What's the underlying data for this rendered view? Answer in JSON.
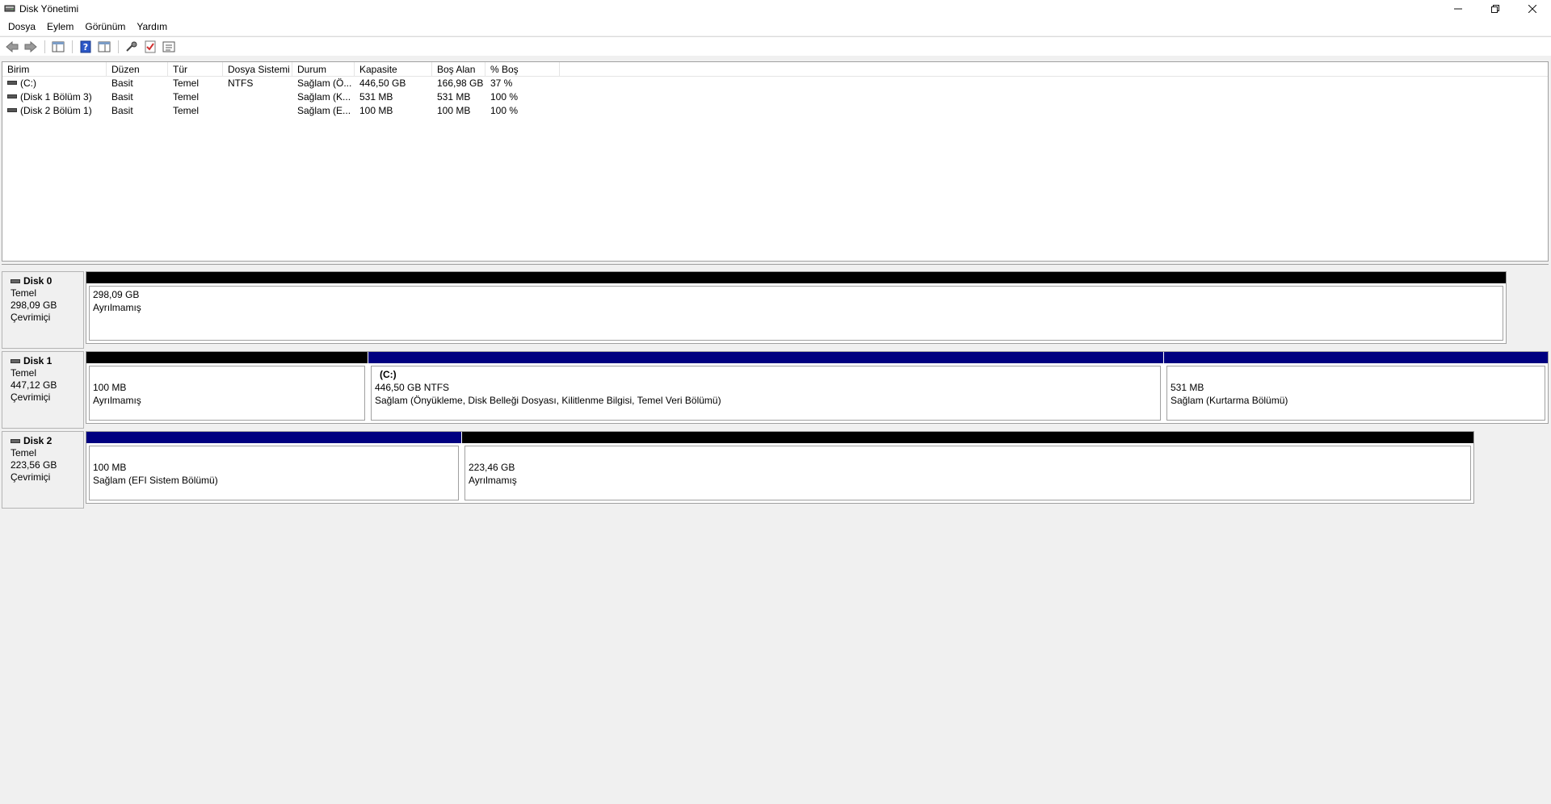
{
  "window": {
    "title": "Disk Yönetimi",
    "controls": {
      "minimize": "—",
      "restore": "❐",
      "close": "✕"
    }
  },
  "menu": [
    "Dosya",
    "Eylem",
    "Görünüm",
    "Yardım"
  ],
  "toolbar": {
    "icons": [
      "back-arrow-icon",
      "forward-arrow-icon",
      "console-tree-icon",
      "help-icon",
      "properties-icon",
      "connect-icon",
      "check-icon",
      "list-icon"
    ]
  },
  "volume_list": {
    "columns": [
      "Birim",
      "Düzen",
      "Tür",
      "Dosya Sistemi",
      "Durum",
      "Kapasite",
      "Boş Alan",
      "% Boş"
    ],
    "rows": [
      [
        "(C:)",
        "Basit",
        "Temel",
        "NTFS",
        "Sağlam (Ö...",
        "446,50 GB",
        "166,98 GB",
        "37 %"
      ],
      [
        "(Disk 1 Bölüm 3)",
        "Basit",
        "Temel",
        "",
        "Sağlam (K...",
        "531 MB",
        "531 MB",
        "100 %"
      ],
      [
        "(Disk 2 Bölüm 1)",
        "Basit",
        "Temel",
        "",
        "Sağlam (E...",
        "100 MB",
        "100 MB",
        "100 %"
      ]
    ]
  },
  "disks": [
    {
      "name": "Disk 0",
      "type": "Temel",
      "size": "298,09 GB",
      "status": "Çevrimiçi",
      "partitions": [
        {
          "name": "",
          "size": "298,09 GB",
          "desc": "Ayrılmamış",
          "bar": "black"
        }
      ]
    },
    {
      "name": "Disk 1",
      "type": "Temel",
      "size": "447,12 GB",
      "status": "Çevrimiçi",
      "partitions": [
        {
          "name": "",
          "size": "100 MB",
          "desc": "Ayrılmamış",
          "bar": "black"
        },
        {
          "name": "(C:)",
          "size": "446,50 GB NTFS",
          "desc": "Sağlam (Önyükleme, Disk Belleği Dosyası, Kilitlenme Bilgisi, Temel Veri Bölümü)",
          "bar": "blue"
        },
        {
          "name": "",
          "size": "531 MB",
          "desc": "Sağlam (Kurtarma Bölümü)",
          "bar": "blue"
        }
      ]
    },
    {
      "name": "Disk 2",
      "type": "Temel",
      "size": "223,56 GB",
      "status": "Çevrimiçi",
      "partitions": [
        {
          "name": "",
          "size": "100 MB",
          "desc": "Sağlam (EFI Sistem Bölümü)",
          "bar": "blue"
        },
        {
          "name": "",
          "size": "223,46 GB",
          "desc": "Ayrılmamış",
          "bar": "black"
        }
      ]
    }
  ]
}
